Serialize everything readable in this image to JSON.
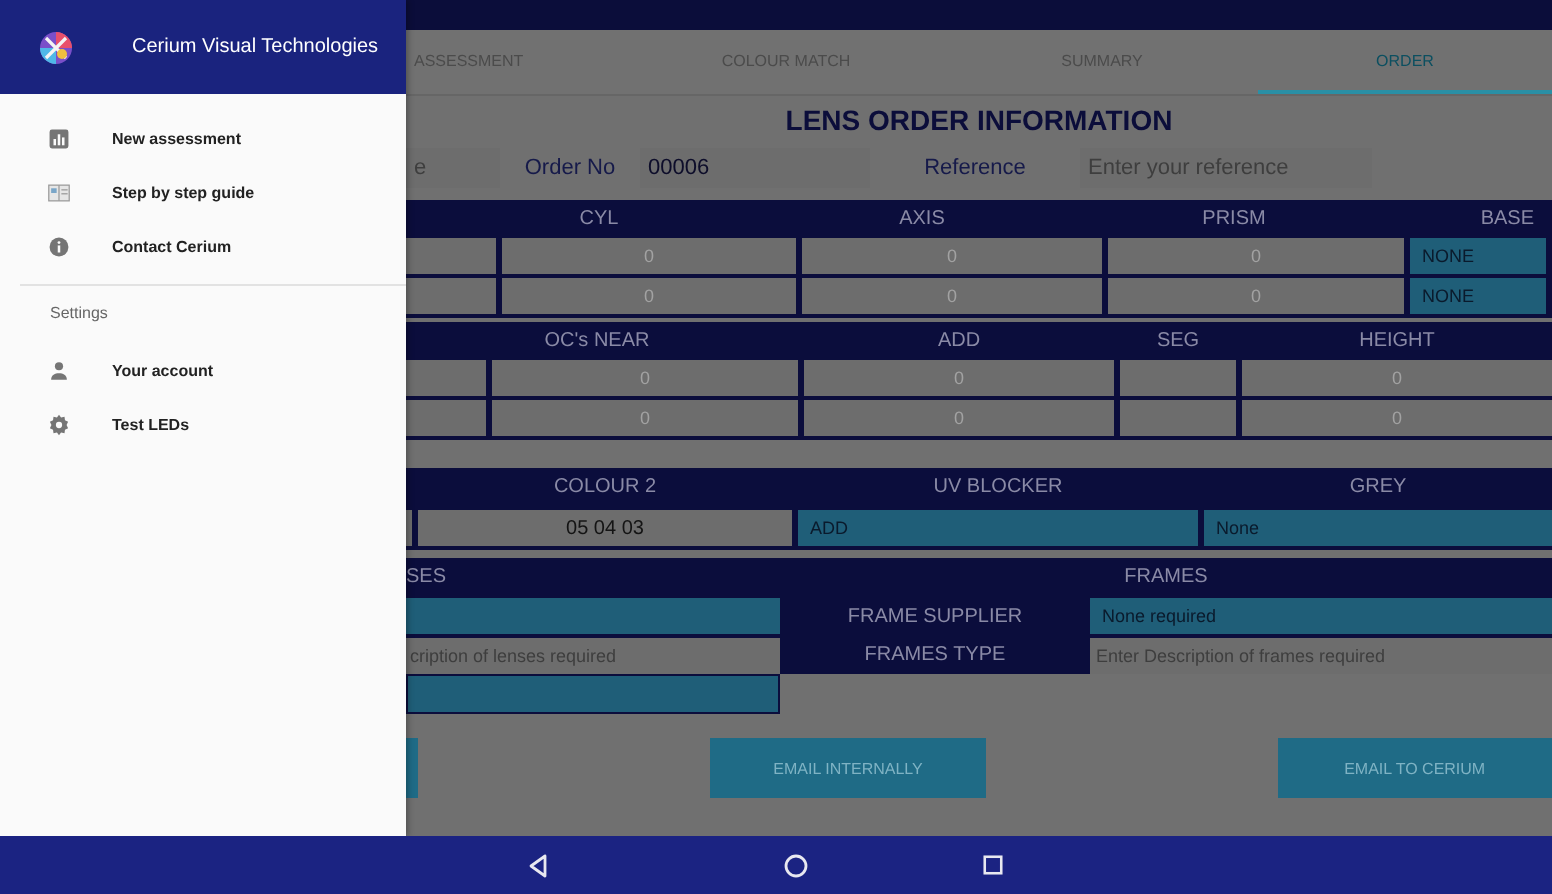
{
  "drawer": {
    "title": "Cerium Visual Technologies",
    "items": [
      {
        "label": "New assessment",
        "kind": "chart"
      },
      {
        "label": "Step by step guide",
        "kind": "book"
      },
      {
        "label": "Contact Cerium",
        "kind": "info"
      }
    ],
    "section": "Settings",
    "settings_items": [
      {
        "label": "Your account",
        "kind": "person"
      },
      {
        "label": "Test LEDs",
        "kind": "gear"
      }
    ]
  },
  "tabs": [
    {
      "label": "ASSESSMENT",
      "selected": false
    },
    {
      "label": "COLOUR MATCH",
      "selected": false
    },
    {
      "label": "SUMMARY",
      "selected": false
    },
    {
      "label": "ORDER",
      "selected": true
    }
  ],
  "title": "LENS ORDER INFORMATION",
  "order_row": {
    "field_1": {
      "placeholder": "e"
    },
    "order_label": "Order No",
    "order_no": "00006",
    "reference_label": "Reference",
    "reference": {
      "placeholder": "Enter your reference"
    }
  },
  "distance": {
    "columns": [
      null,
      "CYL",
      "AXIS",
      "PRISM",
      "BASE"
    ],
    "rows": [
      [
        {
          "kind": "input"
        },
        {
          "kind": "input",
          "placeholder": "0"
        },
        {
          "kind": "input",
          "placeholder": "0"
        },
        {
          "kind": "input",
          "placeholder": "0"
        },
        {
          "kind": "select",
          "value": "NONE"
        }
      ],
      [
        {
          "kind": "input"
        },
        {
          "kind": "input",
          "placeholder": "0"
        },
        {
          "kind": "input",
          "placeholder": "0"
        },
        {
          "kind": "input",
          "placeholder": "0"
        },
        {
          "kind": "select",
          "value": "NONE"
        }
      ]
    ]
  },
  "near": {
    "columns": [
      null,
      "OC's NEAR",
      "ADD",
      "SEG",
      "HEIGHT"
    ],
    "rows": [
      [
        {
          "kind": "input"
        },
        {
          "kind": "input",
          "placeholder": "0"
        },
        {
          "kind": "input",
          "placeholder": "0"
        },
        {
          "kind": "input"
        },
        {
          "kind": "input",
          "placeholder": "0"
        }
      ],
      [
        {
          "kind": "input"
        },
        {
          "kind": "input",
          "placeholder": "0"
        },
        {
          "kind": "input",
          "placeholder": "0"
        },
        {
          "kind": "input"
        },
        {
          "kind": "input",
          "placeholder": "0"
        }
      ]
    ]
  },
  "colour": {
    "columns": [
      null,
      "COLOUR 2",
      "UV BLOCKER",
      "GREY"
    ],
    "row": [
      {
        "kind": "input"
      },
      {
        "kind": "input",
        "value": "05 04 03"
      },
      {
        "kind": "select",
        "value": "ADD"
      },
      {
        "kind": "select",
        "value": "None"
      }
    ]
  },
  "lenses_frames": {
    "lenses_heading": "SES",
    "frames_heading": "FRAMES",
    "lens_supplier": {
      "kind": "select"
    },
    "lens_type": {
      "kind": "input",
      "placeholder": "cription of lenses required"
    },
    "lens_extra": {
      "kind": "select"
    },
    "frame_supplier_label": "FRAME SUPPLIER",
    "frame_supplier": {
      "kind": "select",
      "value": "None required"
    },
    "frames_type_label": "FRAMES TYPE",
    "frames_type": {
      "kind": "input",
      "placeholder": "Enter Description of frames required"
    }
  },
  "buttons": [
    {
      "kind": "partial"
    },
    {
      "kind": "full",
      "label": "EMAIL INTERNALLY"
    },
    {
      "kind": "full",
      "label": "EMAIL TO CERIUM"
    }
  ]
}
